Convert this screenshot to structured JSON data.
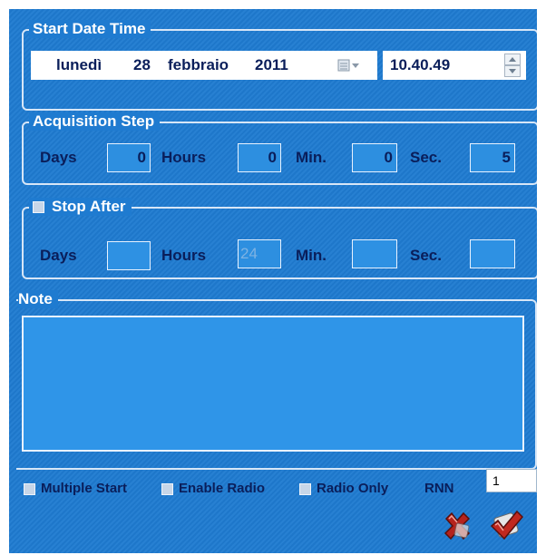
{
  "start": {
    "title": "Start Date Time",
    "day_name": "lunedì",
    "day": "28",
    "month": "febbraio",
    "year": "2011",
    "time": "10.40.49"
  },
  "acquisition": {
    "title": "Acquisition Step",
    "days_label": "Days",
    "days": "0",
    "hours_label": "Hours",
    "hours": "0",
    "min_label": "Min.",
    "min": "0",
    "sec_label": "Sec.",
    "sec": "5"
  },
  "stop": {
    "title": "Stop After",
    "checked": false,
    "days_label": "Days",
    "days": "",
    "hours_label": "Hours",
    "hours": "24",
    "min_label": "Min.",
    "min": "",
    "sec_label": "Sec.",
    "sec": ""
  },
  "note": {
    "title": "Note",
    "text": ""
  },
  "options": {
    "multiple_start": "Multiple Start",
    "enable_radio": "Enable Radio",
    "radio_only": "Radio Only",
    "rnn_label": "RNN",
    "rnn_value": "1"
  },
  "buttons": {
    "cancel_icon": "red-x-cancel-icon",
    "ok_icon": "red-check-ok-icon"
  },
  "colors": {
    "panel": "#1f7bd0",
    "field": "#2d8fe0",
    "text": "#0a1e5a"
  }
}
